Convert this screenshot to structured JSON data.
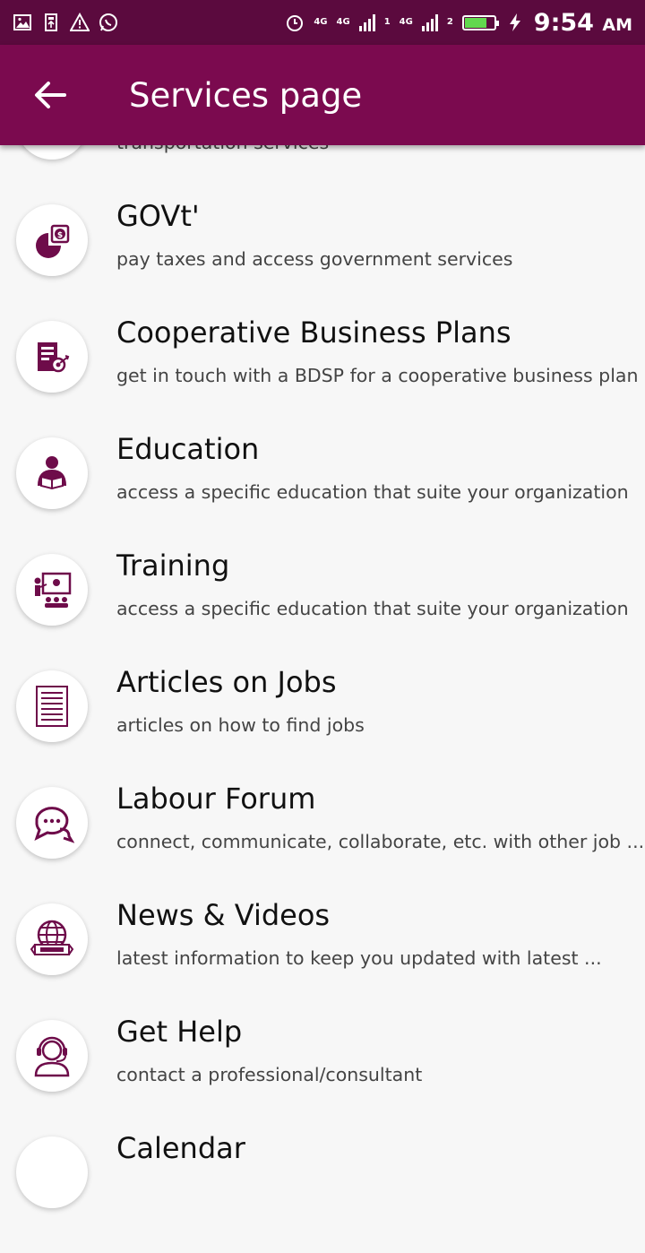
{
  "status_bar": {
    "network_1": "4G",
    "network_2": "4G",
    "sim1": "1",
    "network_3": "4G",
    "sim2": "2",
    "time": "9:54",
    "ampm": "AM",
    "icons": [
      "image-icon",
      "usb-icon",
      "warning-icon",
      "whatsapp-icon",
      "alarm-icon",
      "battery-icon",
      "charging-icon"
    ]
  },
  "app_bar": {
    "title": "Services page",
    "background": "#7b0a4f"
  },
  "accent": "#6e0c4a",
  "services": [
    {
      "title": "",
      "subtitle": "transportation services",
      "icon": "transport-icon"
    },
    {
      "title": "GOVt'",
      "subtitle": "pay taxes and access government services",
      "icon": "pie-chart-dollar-icon"
    },
    {
      "title": "Cooperative Business Plans",
      "subtitle": "get in touch with a BDSP for a cooperative business plan",
      "icon": "business-plan-icon"
    },
    {
      "title": "Education",
      "subtitle": "access a specific education that suite your organization",
      "icon": "student-reading-icon"
    },
    {
      "title": "Training",
      "subtitle": "access a specific education that suite your organization",
      "icon": "presentation-icon"
    },
    {
      "title": "Articles on Jobs",
      "subtitle": "articles on how to find jobs",
      "icon": "article-icon"
    },
    {
      "title": "Labour Forum",
      "subtitle": "connect, communicate, collaborate, etc. with other job ...",
      "icon": "chat-bubbles-icon"
    },
    {
      "title": "News & Videos",
      "subtitle": "latest information to keep you updated with latest ...",
      "icon": "globe-news-icon"
    },
    {
      "title": "Get Help",
      "subtitle": "contact a professional/consultant",
      "icon": "headset-icon"
    },
    {
      "title": "Calendar",
      "subtitle": "",
      "icon": "calendar-icon"
    }
  ]
}
